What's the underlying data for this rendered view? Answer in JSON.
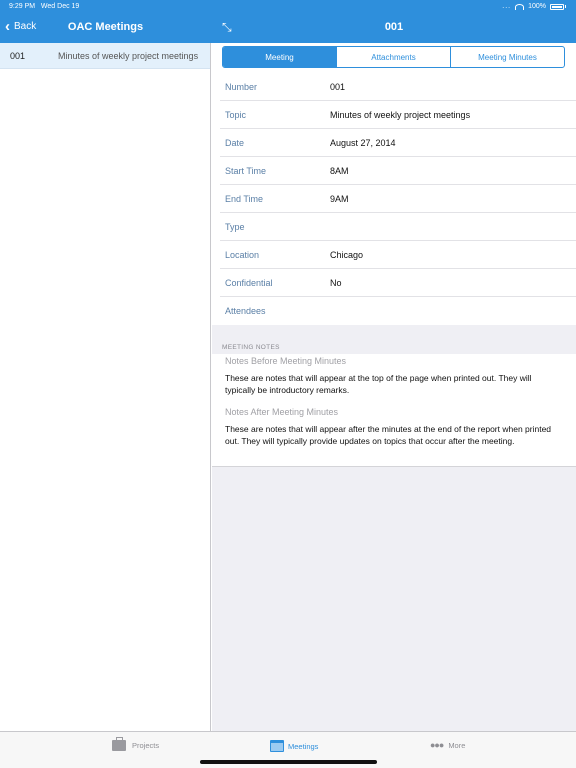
{
  "status_bar": {
    "time": "9:29 PM",
    "date": "Wed Dec 19",
    "battery": "100%",
    "signal_dots": "..."
  },
  "master_nav": {
    "back_label": "Back",
    "title": "OAC Meetings"
  },
  "detail_nav": {
    "title": "001"
  },
  "master_list": [
    {
      "number": "001",
      "topic": "Minutes of weekly project meetings"
    }
  ],
  "segments": [
    {
      "label": "Meeting",
      "active": true
    },
    {
      "label": "Attachments",
      "active": false
    },
    {
      "label": "Meeting Minutes",
      "active": false
    }
  ],
  "fields": [
    {
      "label": "Number",
      "value": "001"
    },
    {
      "label": "Topic",
      "value": "Minutes of weekly project meetings"
    },
    {
      "label": "Date",
      "value": "August 27, 2014"
    },
    {
      "label": "Start Time",
      "value": "8AM"
    },
    {
      "label": "End Time",
      "value": "9AM"
    },
    {
      "label": "Type",
      "value": ""
    },
    {
      "label": "Location",
      "value": "Chicago"
    },
    {
      "label": "Confidential",
      "value": "No"
    },
    {
      "label": "Attendees",
      "value": ""
    }
  ],
  "notes_section": {
    "header": "MEETING NOTES",
    "before_title": "Notes Before Meeting Minutes",
    "before_body": "These are notes that will appear at the top of the page when printed out.  They will typically be introductory remarks.",
    "after_title": "Notes After Meeting Minutes",
    "after_body": "These are notes that will appear after the minutes at the end of the report when printed out.  They will typically provide updates on topics that occur after the meeting."
  },
  "tabbar": {
    "projects": "Projects",
    "meetings": "Meetings",
    "more": "More"
  },
  "colors": {
    "accent": "#2e8fdc",
    "label": "#5a7fa6",
    "selected_row": "#e3f0fb"
  }
}
